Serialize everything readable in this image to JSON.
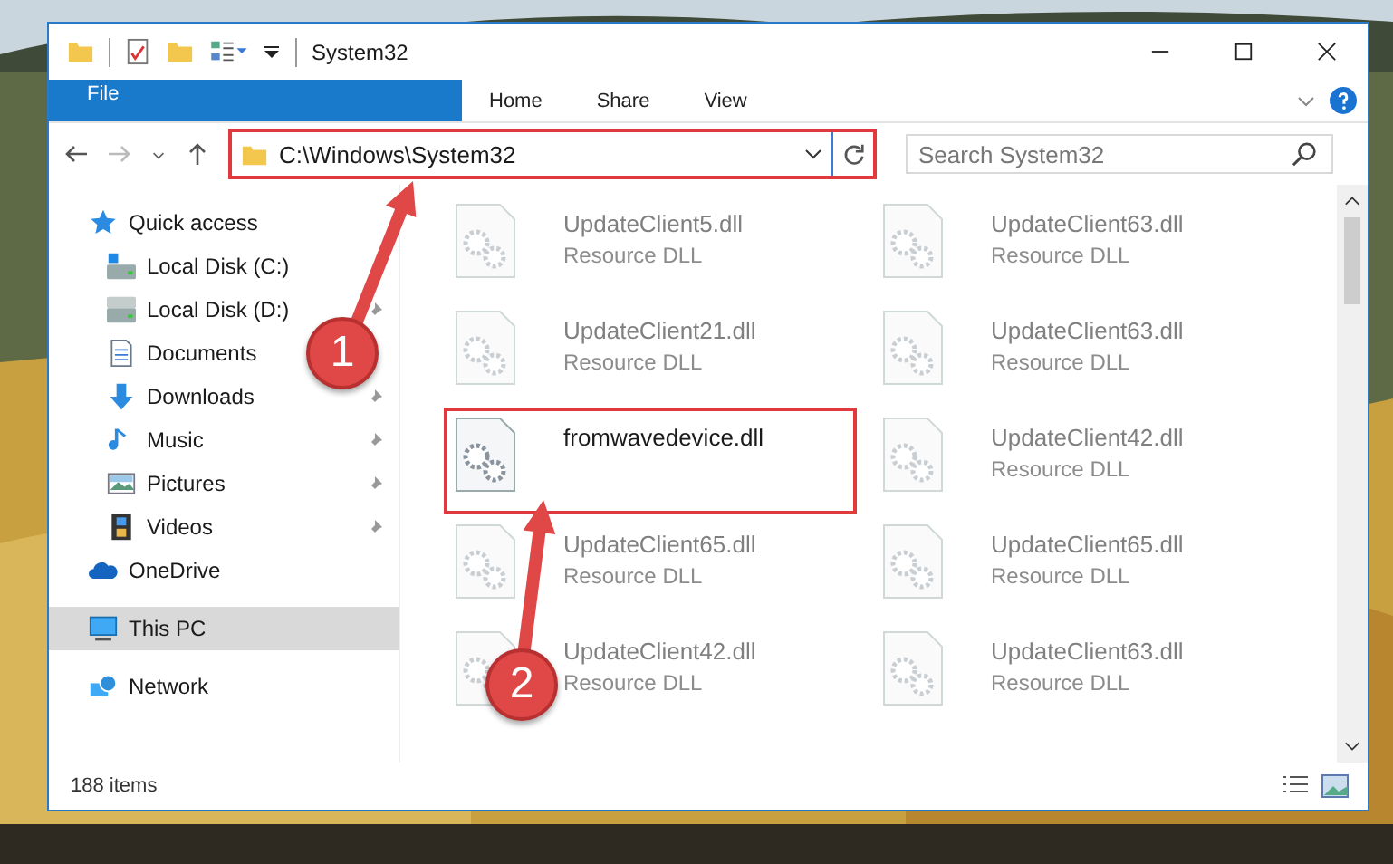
{
  "window": {
    "title": "System32"
  },
  "ribbon": {
    "tabs": [
      {
        "label": "File",
        "kind": "file",
        "selected": false
      },
      {
        "label": "Home",
        "kind": "tab",
        "selected": false
      },
      {
        "label": "Share",
        "kind": "tab",
        "selected": false
      },
      {
        "label": "View",
        "kind": "tab",
        "selected": false
      }
    ]
  },
  "address": {
    "path": "C:\\Windows\\System32",
    "highlighted": true
  },
  "search": {
    "placeholder": "Search System32"
  },
  "sidebar": {
    "items": [
      {
        "label": "Quick access",
        "kind": "star",
        "selected": false,
        "children": [
          {
            "label": "Local Disk (C:)",
            "kind": "drive-c",
            "pinned": false,
            "selected": false
          },
          {
            "label": "Local Disk (D:)",
            "kind": "drive",
            "pinned": true,
            "selected": false
          },
          {
            "label": "Documents",
            "kind": "document",
            "pinned": false,
            "selected": false
          },
          {
            "label": "Downloads",
            "kind": "download",
            "pinned": true,
            "selected": false
          },
          {
            "label": "Music",
            "kind": "music",
            "pinned": true,
            "selected": false
          },
          {
            "label": "Pictures",
            "kind": "pictures",
            "pinned": true,
            "selected": false
          },
          {
            "label": "Videos",
            "kind": "videos",
            "pinned": true,
            "selected": false
          }
        ]
      },
      {
        "label": "OneDrive",
        "kind": "cloud",
        "selected": false
      },
      {
        "label": "This PC",
        "kind": "pc",
        "selected": true
      },
      {
        "label": "Network",
        "kind": "network",
        "selected": false
      }
    ]
  },
  "files": [
    {
      "name": "UpdateClient5.dll",
      "type": "Resource DLL",
      "blurred": true,
      "highlighted": false
    },
    {
      "name": "UpdateClient63.dll",
      "type": "Resource DLL",
      "blurred": true,
      "highlighted": false
    },
    {
      "name": "UpdateClient21.dll",
      "type": "Resource DLL",
      "blurred": true,
      "highlighted": false
    },
    {
      "name": "UpdateClient63.dll",
      "type": "Resource DLL",
      "blurred": true,
      "highlighted": false
    },
    {
      "name": "fromwavedevice.dll",
      "blurred": false,
      "highlighted": true
    },
    {
      "name": "UpdateClient42.dll",
      "type": "Resource DLL",
      "blurred": true,
      "highlighted": false
    },
    {
      "name": "UpdateClient65.dll",
      "type": "Resource DLL",
      "blurred": true,
      "highlighted": false
    },
    {
      "name": "UpdateClient65.dll",
      "type": "Resource DLL",
      "blurred": true,
      "highlighted": false
    },
    {
      "name": "UpdateClient42.dll",
      "type": "Resource DLL",
      "blurred": true,
      "highlighted": false
    },
    {
      "name": "UpdateClient63.dll",
      "type": "Resource DLL",
      "blurred": true,
      "highlighted": false
    }
  ],
  "status_bar": {
    "count": "188 items"
  },
  "callouts": [
    {
      "label": "1"
    },
    {
      "label": "2"
    }
  ]
}
